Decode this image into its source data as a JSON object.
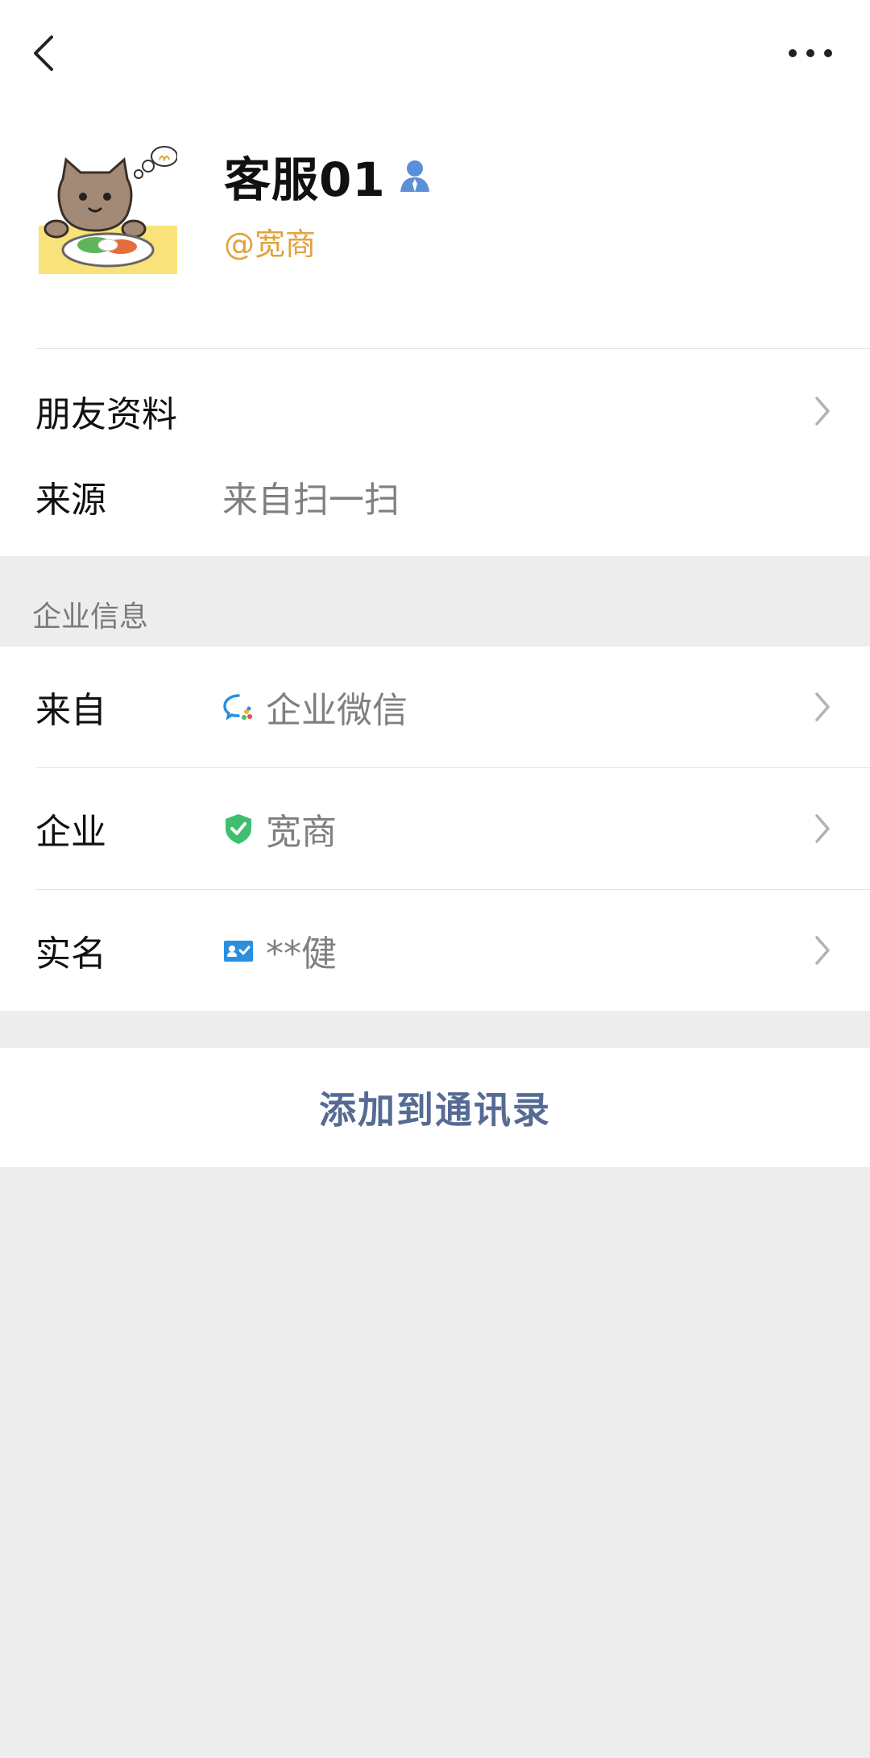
{
  "header": {
    "name": "客服01",
    "handle": "@宽商"
  },
  "rows": {
    "friend_info": {
      "label": "朋友资料"
    },
    "source": {
      "label": "来源",
      "value": "来自扫一扫"
    }
  },
  "enterprise": {
    "section_title": "企业信息",
    "from": {
      "label": "来自",
      "value": "企业微信",
      "icon": "wecom-icon"
    },
    "company": {
      "label": "企业",
      "value": "宽商",
      "icon": "verified-shield-icon"
    },
    "real_name": {
      "label": "实名",
      "value": "**健",
      "icon": "id-card-icon"
    }
  },
  "actions": {
    "add_contact": "添加到通讯录"
  },
  "colors": {
    "handle": "#e2a23b",
    "add_button_text": "#566b94",
    "background": "#ededed"
  }
}
